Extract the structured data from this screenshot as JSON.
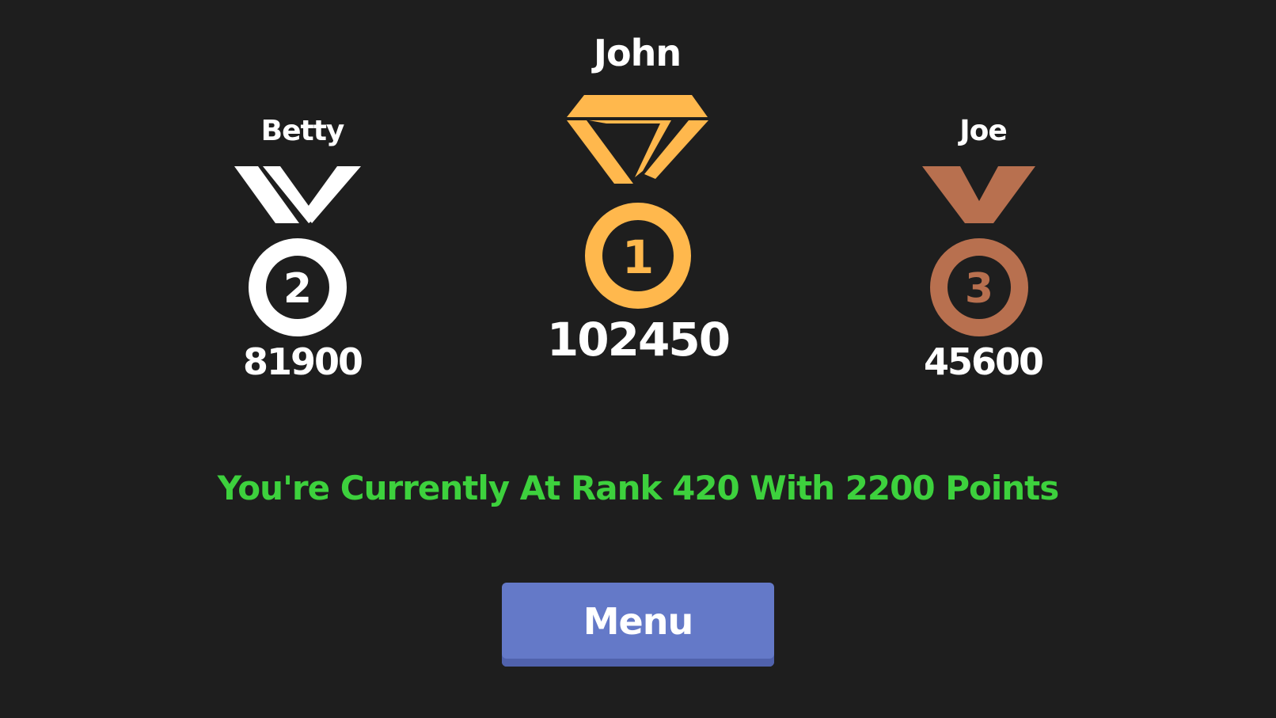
{
  "leaderboard": {
    "first": {
      "name": "John",
      "score": "102450",
      "rank_digit": "1",
      "color": "#ffb84d"
    },
    "second": {
      "name": "Betty",
      "score": "81900",
      "rank_digit": "2",
      "color": "#ffffff"
    },
    "third": {
      "name": "Joe",
      "score": "45600",
      "rank_digit": "3",
      "color": "#b8704f"
    }
  },
  "status": {
    "message": "You're Currently At Rank 420 With 2200 Points",
    "color": "#3dd13d"
  },
  "menu": {
    "label": "Menu",
    "color": "#6479c8"
  },
  "icons": [
    "gold-medal-icon",
    "silver-medal-icon",
    "bronze-medal-icon"
  ]
}
